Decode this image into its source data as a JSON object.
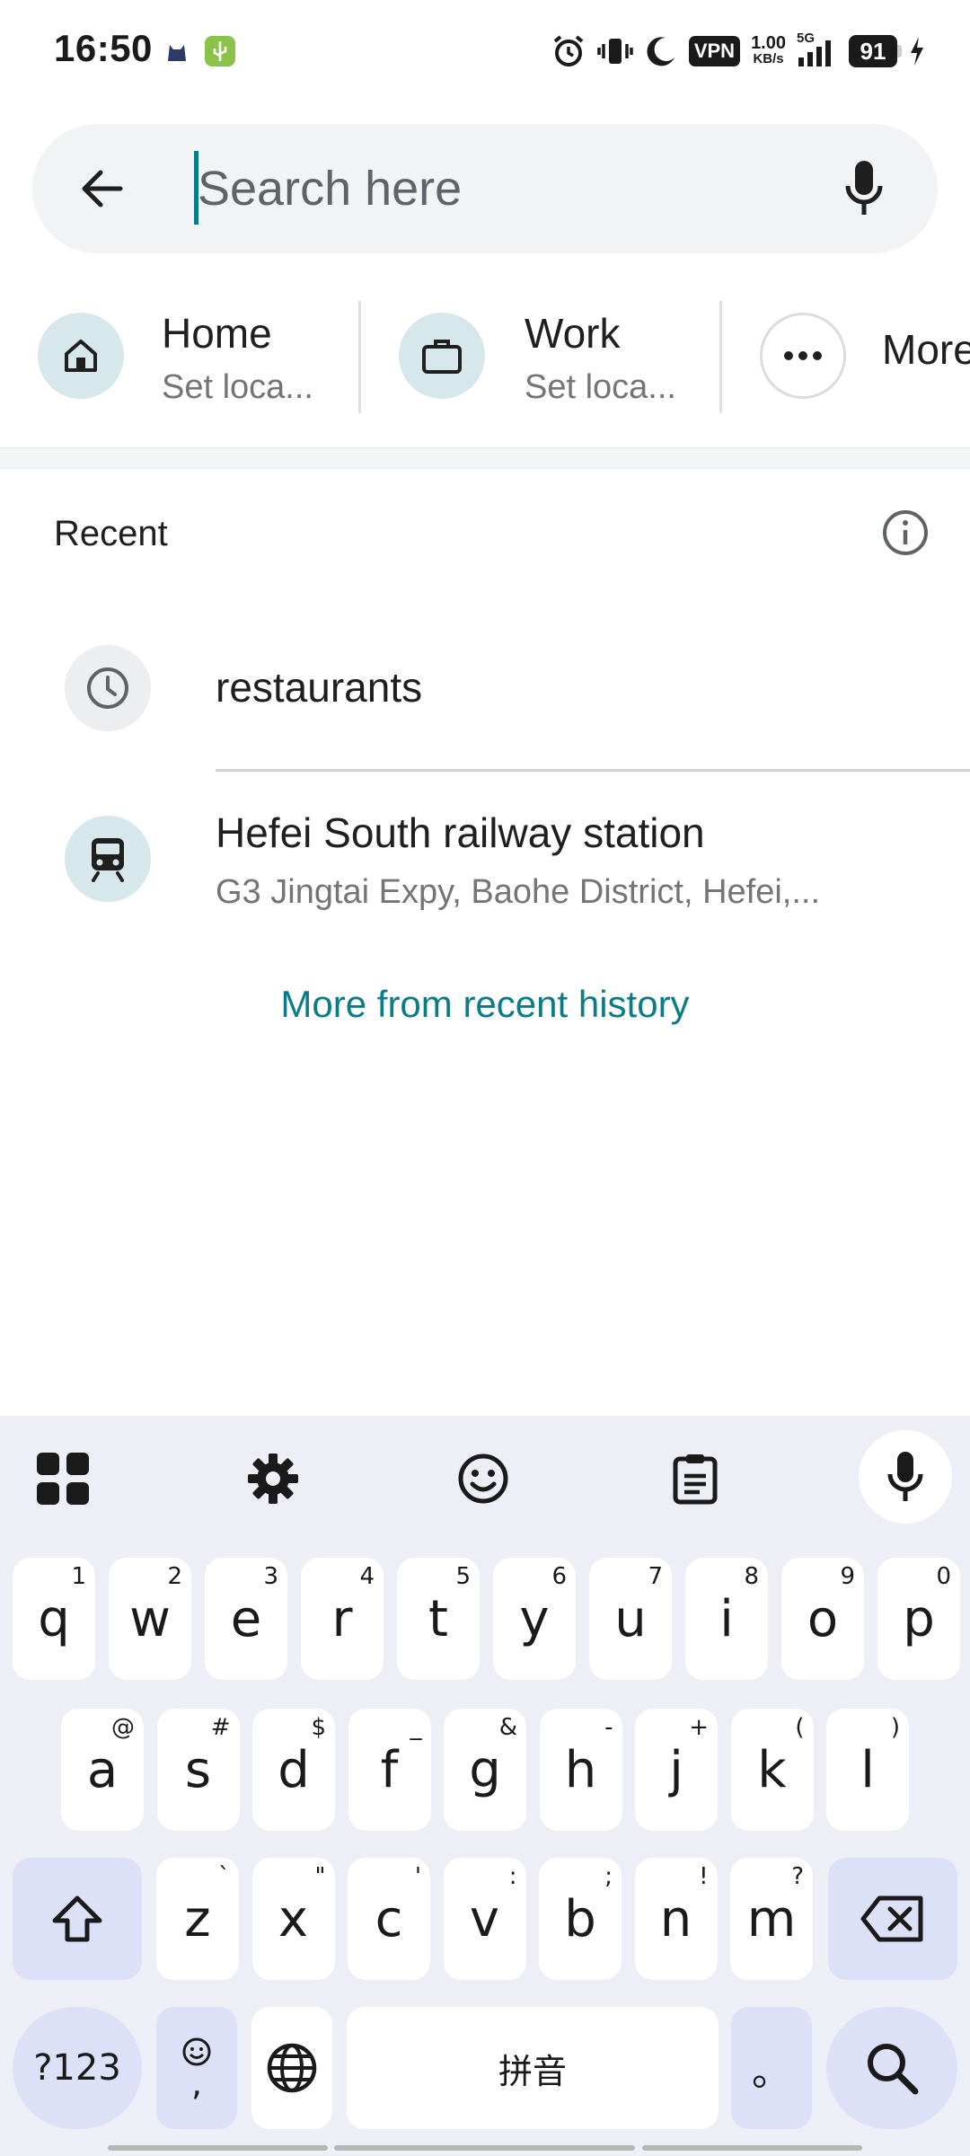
{
  "status_bar": {
    "time": "16:50",
    "vpn": "VPN",
    "net_speed_value": "1.00",
    "net_speed_unit": "KB/s",
    "network": "5G",
    "battery": "91",
    "icons": [
      "alarm-icon",
      "vibrate-icon",
      "moon-icon",
      "vpn-icon",
      "signal-icon",
      "battery-icon",
      "charging-icon"
    ]
  },
  "search": {
    "placeholder": "Search here",
    "value": ""
  },
  "shortcuts": [
    {
      "title": "Home",
      "subtitle": "Set loca...",
      "icon": "home-icon"
    },
    {
      "title": "Work",
      "subtitle": "Set loca...",
      "icon": "briefcase-icon"
    },
    {
      "title": "More",
      "icon": "more-icon"
    }
  ],
  "recent": {
    "header": "Recent",
    "items": [
      {
        "title": "restaurants",
        "icon": "history-icon"
      },
      {
        "title": "Hefei South railway station",
        "subtitle": "G3 Jingtai Expy, Baohe District, Hefei,...",
        "icon": "train-icon"
      }
    ],
    "more_link": "More from recent history"
  },
  "keyboard": {
    "row1": [
      {
        "k": "q",
        "h": "1"
      },
      {
        "k": "w",
        "h": "2"
      },
      {
        "k": "e",
        "h": "3"
      },
      {
        "k": "r",
        "h": "4"
      },
      {
        "k": "t",
        "h": "5"
      },
      {
        "k": "y",
        "h": "6"
      },
      {
        "k": "u",
        "h": "7"
      },
      {
        "k": "i",
        "h": "8"
      },
      {
        "k": "o",
        "h": "9"
      },
      {
        "k": "p",
        "h": "0"
      }
    ],
    "row2": [
      {
        "k": "a",
        "h": "@"
      },
      {
        "k": "s",
        "h": "#"
      },
      {
        "k": "d",
        "h": "$"
      },
      {
        "k": "f",
        "h": "_"
      },
      {
        "k": "g",
        "h": "&"
      },
      {
        "k": "h",
        "h": "-"
      },
      {
        "k": "j",
        "h": "+"
      },
      {
        "k": "k",
        "h": "("
      },
      {
        "k": "l",
        "h": ")"
      }
    ],
    "row3": [
      {
        "k": "z",
        "h": "`"
      },
      {
        "k": "x",
        "h": "\""
      },
      {
        "k": "c",
        "h": "'"
      },
      {
        "k": "v",
        "h": ":"
      },
      {
        "k": "b",
        "h": ";"
      },
      {
        "k": "n",
        "h": "!"
      },
      {
        "k": "m",
        "h": "?"
      }
    ],
    "symbols_key": "?123",
    "comma_key": ",",
    "space_key": "拼音",
    "period_key": "。"
  },
  "colors": {
    "accent": "#0b7c86",
    "icon_bg": "#d6e8ec",
    "keyboard_bg": "#eeeff6",
    "mod_key": "#dde1f7"
  }
}
